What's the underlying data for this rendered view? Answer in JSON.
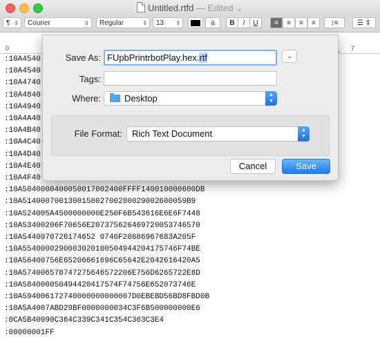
{
  "window": {
    "title": "Untitled.rtfd",
    "edited": "— Edited",
    "chevron": "⌄"
  },
  "toolbar": {
    "paragraph_style": "¶",
    "font_family": "Courier",
    "typeface": "Regular",
    "font_size": "13",
    "bold": "B",
    "italic": "I",
    "underline": "U"
  },
  "ruler": {
    "start": "0",
    "end": "7"
  },
  "document": {
    "lines": [
      ":10A4540",
      ":10A4540",
      ":10A4740",
      ":10A4840",
      ":10A4940",
      ":10A4A40",
      ":10A4B40",
      ":10A4C40",
      ":10A4D40",
      ":10A4E40",
      ":10A4F40",
      ":10A5040000400050017002400FFFF140010000600DB",
      ":10A514000700130015002700280029002600059B9",
      ":10A524005A4500000000E250F6B543616E6E6F7448",
      ":10A53400206F70656E207375626469720053746570",
      ":10A5440070726174652 0746F20686967683A205F",
      ":10A5540000290003020100504944204175746F74BE",
      ":10A56400756E65206661696C65642E2042616420A5",
      ":10A574006578747275646572206E756D6265722E8D",
      ":10A584000050494420417574F74756E652073746E",
      ":10A594006172740000000000007D0EBEBD56BD8FBD0B",
      ":10A5A4007ABD29BF0000000034C3F6B500000000E6",
      ":0CA5B40090C364C339C341C354C363C3E4",
      ":00000001FF"
    ]
  },
  "dialog": {
    "save_as_label": "Save As:",
    "save_as_base": "FUpbPrintrbotPlay.hex.",
    "save_as_ext": "rtf",
    "tags_label": "Tags:",
    "tags_value": "",
    "where_label": "Where:",
    "where_value": "Desktop",
    "format_label": "File Format:",
    "format_value": "Rich Text Document",
    "cancel_label": "Cancel",
    "save_label": "Save"
  },
  "colors": {
    "accent": "#1b7cf2",
    "close": "#fc605c",
    "minimize": "#fdbc40",
    "maximize": "#34c84a"
  }
}
